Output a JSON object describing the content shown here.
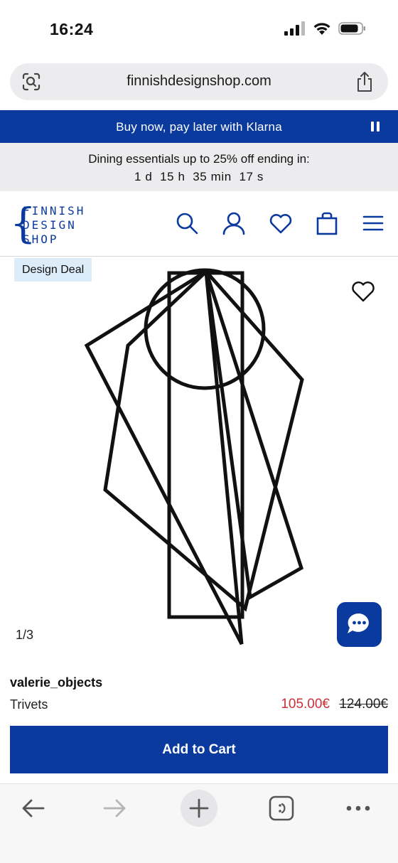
{
  "status_bar": {
    "time": "16:24"
  },
  "browser": {
    "url": "finnishdesignshop.com"
  },
  "klarna_banner": {
    "text": "Buy now, pay later with Klarna"
  },
  "promo": {
    "text": "Dining essentials up to 25% off ending in:",
    "countdown": "1 d  15 h  35 min  17 s"
  },
  "logo": {
    "line1": "FINNISH",
    "line2": "DESIGN",
    "line3": "SHOP"
  },
  "product": {
    "badge": "Design Deal",
    "image_counter": "1/3",
    "brand": "valerie_objects",
    "name": "Trivets",
    "sale_price": "105.00€",
    "original_price": "124.00€",
    "add_to_cart_label": "Add to Cart"
  },
  "colors": {
    "brand_blue": "#0a3a9e",
    "sale_red": "#c8323a",
    "badge_bg": "#dcecf8"
  },
  "icons": {
    "header": [
      "search-icon",
      "account-icon",
      "heart-icon",
      "bag-icon",
      "menu-icon"
    ],
    "toolbar": [
      "back-icon",
      "forward-icon",
      "new-tab-icon",
      "tabs-icon",
      "more-icon"
    ]
  }
}
